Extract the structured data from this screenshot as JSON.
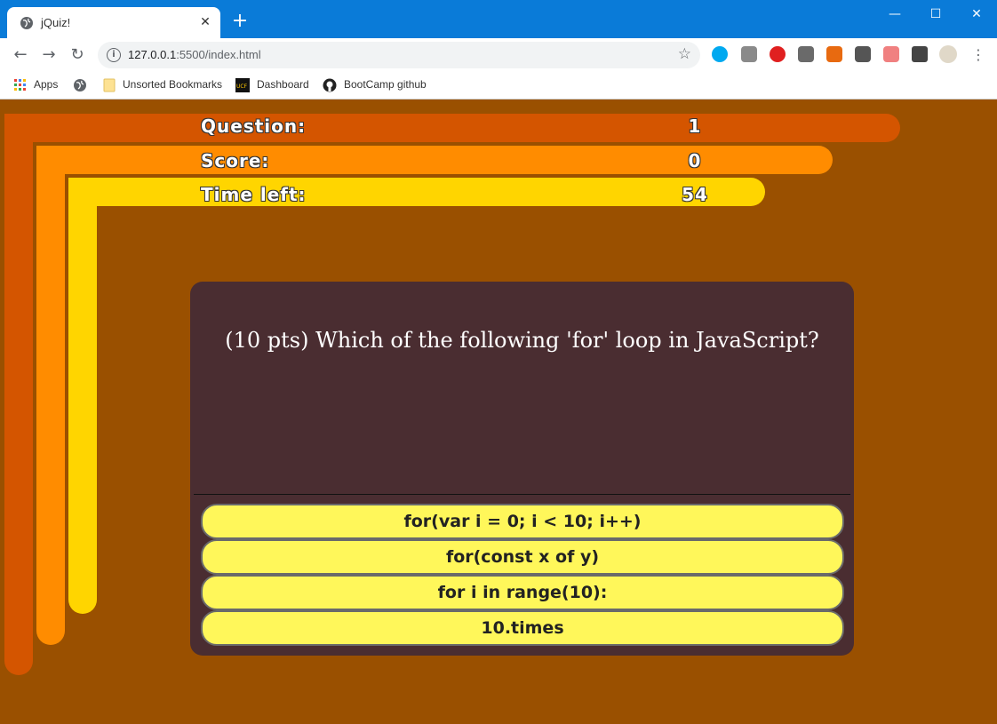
{
  "browser": {
    "tab_title": "jQuiz!",
    "tab_close": "✕",
    "new_tab": "+",
    "window_controls": {
      "minimize": "—",
      "maximize": "☐",
      "close": "✕"
    },
    "url_host": "127.0.0.1",
    "url_rest": ":5500/index.html",
    "bookmarks": [
      {
        "label": "Apps",
        "icon": "apps-grid-icon"
      },
      {
        "label": "",
        "icon": "globe-icon"
      },
      {
        "label": "Unsorted Bookmarks",
        "icon": "folder-icon"
      },
      {
        "label": "Dashboard",
        "icon": "ucf-logo-icon"
      },
      {
        "label": "BootCamp github",
        "icon": "github-icon"
      }
    ]
  },
  "status": {
    "question_label": "Question:",
    "question_value": "1",
    "score_label": "Score:",
    "score_value": "0",
    "time_label": "Time left:",
    "time_value": "54"
  },
  "colors": {
    "background": "#9a5000",
    "bar_question": "#d45500",
    "bar_score": "#ff8c00",
    "bar_time": "#ffd500",
    "card": "#4a2d31",
    "answer": "#fff75a"
  },
  "quiz": {
    "question": "(10 pts) Which of the following 'for' loop in JavaScript?",
    "answers": [
      "for(var i = 0; i < 10; i++)",
      "for(const x of y)",
      "for i in range(10):",
      "10.times"
    ]
  }
}
